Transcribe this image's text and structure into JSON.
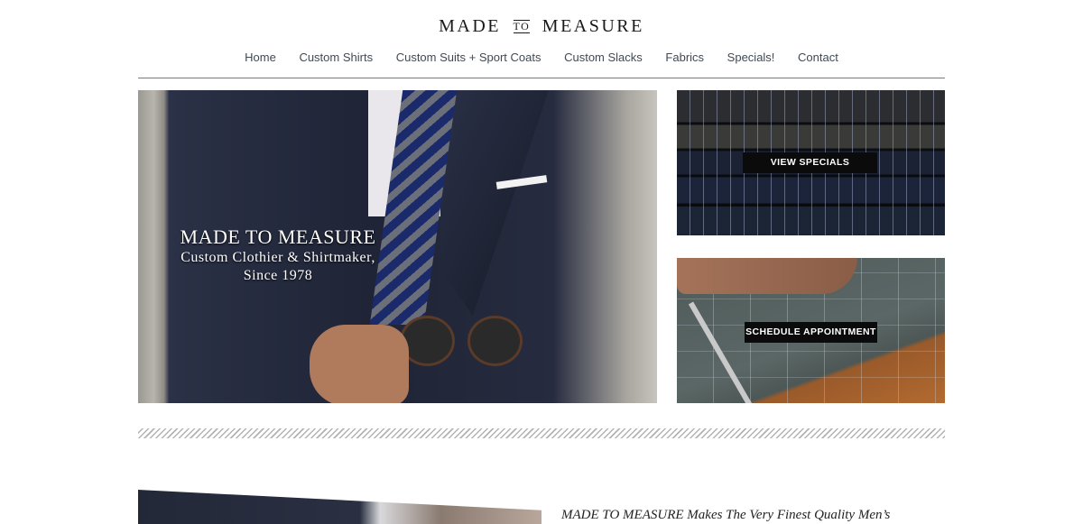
{
  "logo": {
    "left": "MADE",
    "middle": "TO",
    "right": "MEASURE"
  },
  "nav": {
    "items": [
      "Home",
      "Custom Shirts",
      "Custom Suits + Sport Coats",
      "Custom Slacks",
      "Fabrics",
      "Specials!",
      "Contact"
    ]
  },
  "hero": {
    "title": "MADE TO MEASURE",
    "subtitle_line1": "Custom Clothier & Shirtmaker,",
    "subtitle_line2": "Since 1978"
  },
  "tiles": {
    "specials_label": "VIEW SPECIALS",
    "appointment_label": "SCHEDULE APPOINTMENT"
  },
  "intro": {
    "text": "MADE TO MEASURE Makes The Very Finest Quality Men’s"
  }
}
